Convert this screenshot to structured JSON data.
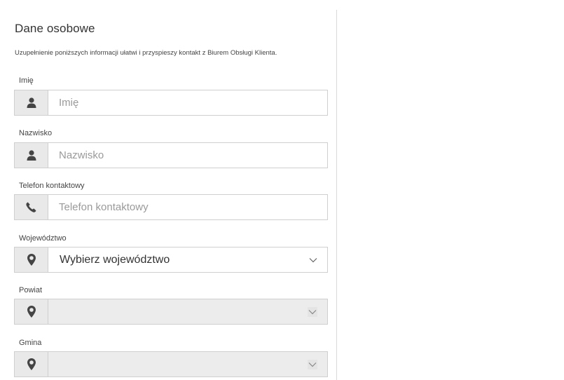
{
  "section": {
    "title": "Dane osobowe",
    "description": "Uzupełnienie poniższych informacji ułatwi i przyspieszy kontakt z Biurem Obsługi Klienta."
  },
  "fields": {
    "first_name": {
      "label": "Imię",
      "placeholder": "Imię",
      "icon": "user-icon"
    },
    "last_name": {
      "label": "Nazwisko",
      "placeholder": "Nazwisko",
      "icon": "user-icon"
    },
    "phone": {
      "label": "Telefon kontaktowy",
      "placeholder": "Telefon kontaktowy",
      "icon": "phone-icon"
    },
    "voivodeship": {
      "label": "Województwo",
      "value": "Wybierz województwo",
      "icon": "map-marker-icon"
    },
    "county": {
      "label": "Powiat",
      "value": "",
      "icon": "map-marker-icon",
      "disabled": true
    },
    "commune": {
      "label": "Gmina",
      "value": "",
      "icon": "map-marker-icon",
      "disabled": true
    }
  },
  "colors": {
    "addon_bg": "#e9e9e9",
    "icon": "#444444",
    "border": "#cfcfcf",
    "disabled_bg": "#ececec"
  }
}
